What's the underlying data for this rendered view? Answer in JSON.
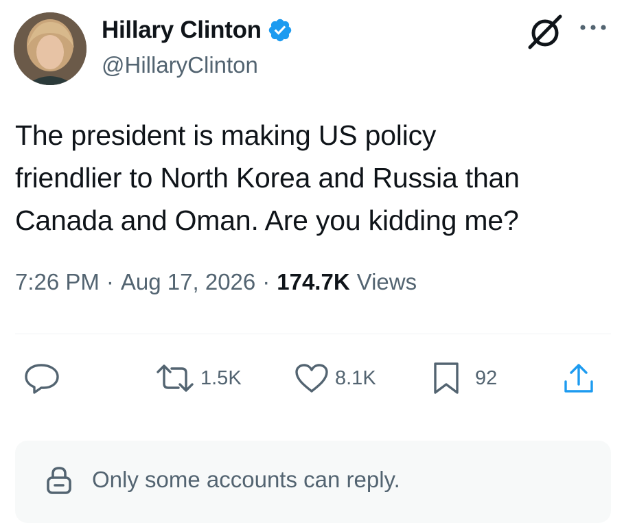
{
  "author": {
    "display_name": "Hillary Clinton",
    "handle": "@HillaryClinton",
    "verified": true,
    "verified_color": "#1d9bf0"
  },
  "tweet": {
    "text": "The president is making US policy\nfriendlier to North Korea and Russia than\nCanada and Oman. Are you kidding me?",
    "time": "7:26 PM",
    "separator": "·",
    "date": "Aug 17, 2026",
    "views_count": "174.7K",
    "views_label": "Views"
  },
  "actions": {
    "reply": {
      "icon": "reply-icon"
    },
    "retweet": {
      "icon": "retweet-icon",
      "count": "1.5K"
    },
    "like": {
      "icon": "heart-icon",
      "count": "8.1K"
    },
    "bookmark": {
      "icon": "bookmark-icon",
      "count": "92"
    },
    "share": {
      "icon": "share-icon"
    }
  },
  "header_icons": {
    "grok": "grok-icon",
    "more": "more-icon"
  },
  "reply_restriction": {
    "icon": "lock-icon",
    "text": "Only some accounts can reply."
  },
  "colors": {
    "text_primary": "#0f1419",
    "text_secondary": "#536471",
    "accent": "#1d9bf0",
    "restriction_bg": "#f7f9f9"
  }
}
